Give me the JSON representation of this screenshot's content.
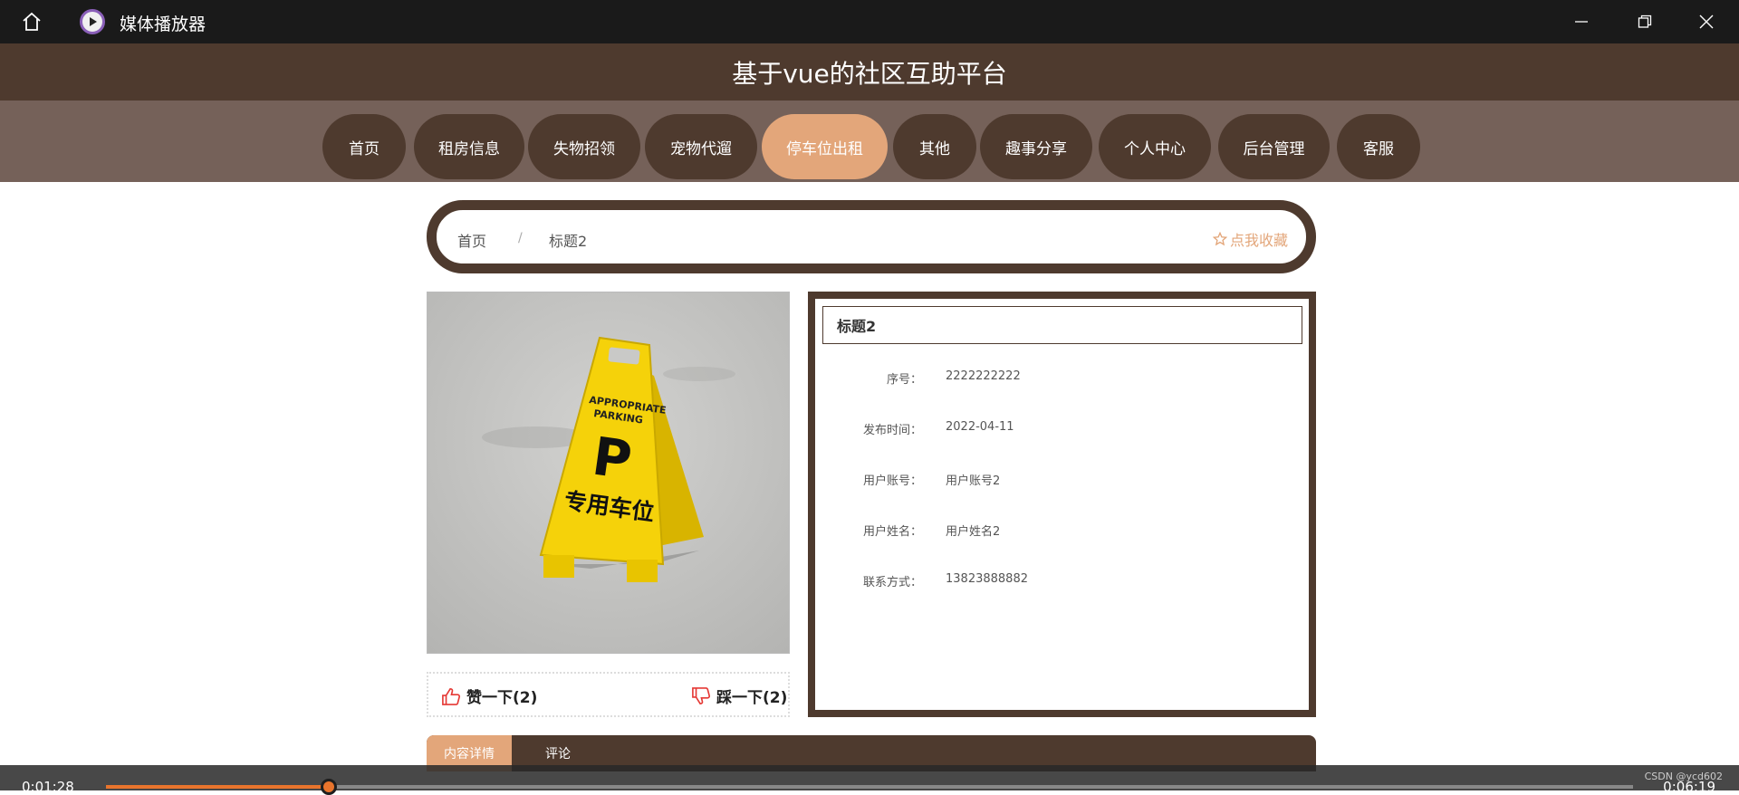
{
  "player": {
    "app_title": "媒体播放器",
    "time_elapsed": "0:01:28",
    "time_total": "0:06:19",
    "progress_fraction": 0.146,
    "watermark": "CSDN @ycd602"
  },
  "site": {
    "title": "基于vue的社区互助平台"
  },
  "nav": {
    "items": [
      {
        "label": "首页"
      },
      {
        "label": "租房信息"
      },
      {
        "label": "失物招领"
      },
      {
        "label": "宠物代遛"
      },
      {
        "label": "停车位出租",
        "active": true
      },
      {
        "label": "其他"
      },
      {
        "label": "趣事分享"
      },
      {
        "label": "个人中心"
      },
      {
        "label": "后台管理"
      },
      {
        "label": "客服"
      }
    ]
  },
  "breadcrumb": {
    "home": "首页",
    "separator": "/",
    "current": "标题2",
    "favorite": "点我收藏"
  },
  "photo": {
    "sign_line1": "APPROPRIATE",
    "sign_line2": "PARKING",
    "sign_letter": "P",
    "sign_text": "专用车位"
  },
  "votes": {
    "like": "赞一下(2)",
    "dislike": "踩一下(2)"
  },
  "detail": {
    "title": "标题2",
    "fields": [
      {
        "label": "序号：",
        "value": "2222222222"
      },
      {
        "label": "发布时间：",
        "value": "2022-04-11"
      },
      {
        "label": "用户账号：",
        "value": "用户账号2"
      },
      {
        "label": "用户姓名：",
        "value": "用户姓名2"
      },
      {
        "label": "联系方式：",
        "value": "13823888882"
      }
    ]
  },
  "tabs": {
    "items": [
      {
        "label": "内容详情",
        "active": true
      },
      {
        "label": "评论"
      }
    ]
  },
  "colors": {
    "brand_dark": "#4e3a2e",
    "accent": "#e3a67a",
    "progress": "#e8742c"
  }
}
